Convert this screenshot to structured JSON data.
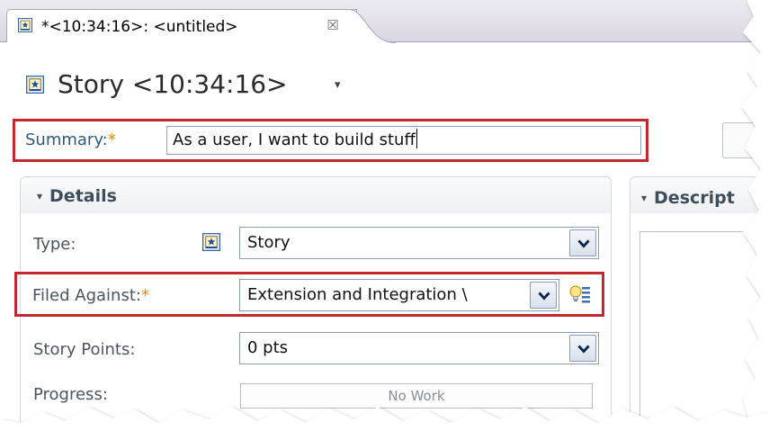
{
  "tab": {
    "title": "*<10:34:16>: <untitled>",
    "close_glyph": "☒",
    "icon": "story-icon",
    "close_icon": "close-icon"
  },
  "editor": {
    "title": "Story <10:34:16>",
    "title_menu_glyph": "▾",
    "icon": "story-icon"
  },
  "summary": {
    "label": "Summary:",
    "required_mark": "*",
    "value": "As a user, I want to build stuff"
  },
  "details": {
    "toggle_glyph": "▾",
    "title": "Details",
    "type": {
      "label": "Type:",
      "value": "Story",
      "icon": "story-icon"
    },
    "filed_against": {
      "label": "Filed Against:",
      "required_mark": "*",
      "value": "Extension and Integration \\",
      "assist_icon": "lightbulb-icon"
    },
    "story_points": {
      "label": "Story Points:",
      "value": "0 pts"
    },
    "progress": {
      "label": "Progress:",
      "text": "No Work",
      "fraction": 0
    }
  },
  "description": {
    "toggle_glyph": "▾",
    "title": "Descript"
  },
  "colors": {
    "highlight_border": "#c4282e",
    "required": "#f08c00",
    "label": "#4a5560",
    "summary_label": "#2e5a7a"
  }
}
